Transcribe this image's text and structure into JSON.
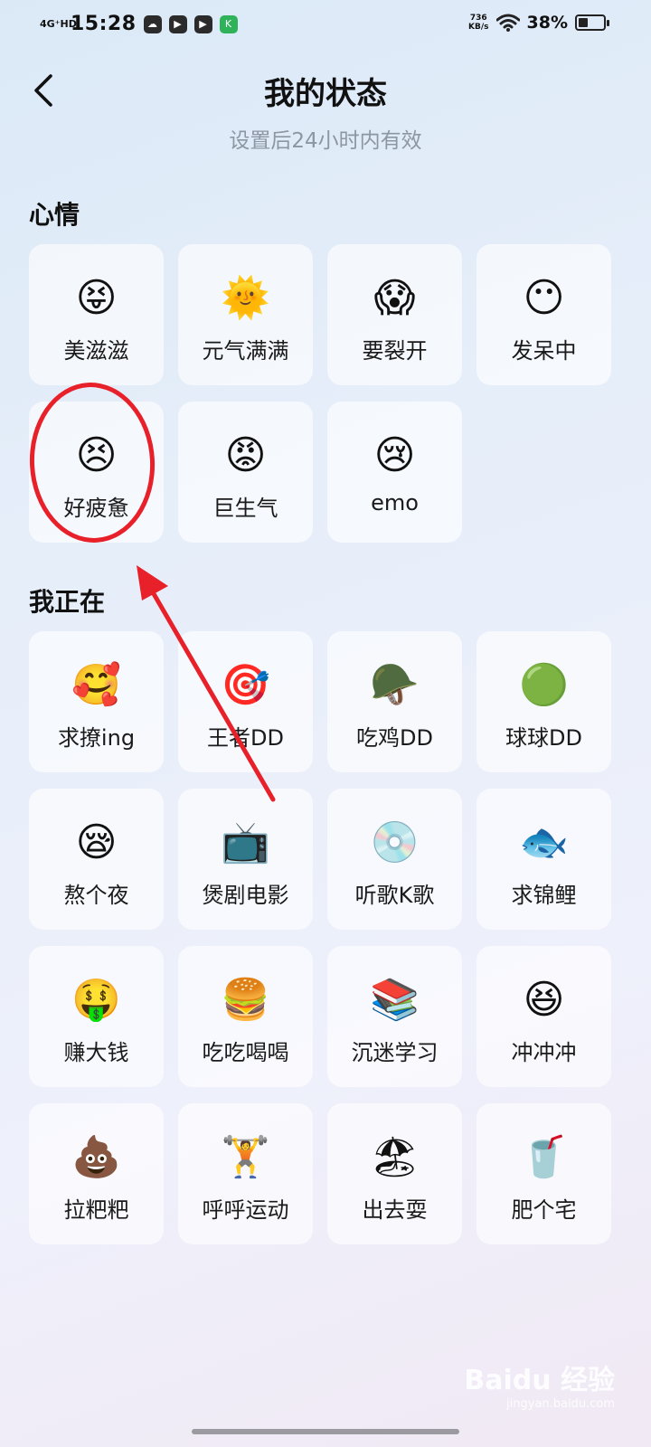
{
  "status_bar": {
    "network": "4G⁺HD",
    "time": "15:28",
    "speed_value": "736",
    "speed_unit": "KB/s",
    "battery_text": "38%",
    "battery_level": 0.38,
    "app_icons": [
      "cloud-icon",
      "play-icon",
      "play-icon",
      "k-app-icon"
    ]
  },
  "header": {
    "title": "我的状态",
    "subtitle": "设置后24小时内有效"
  },
  "mood": {
    "heading": "心情",
    "items": [
      {
        "label": "美滋滋",
        "emoji": "😝",
        "icon": "happy-face-icon"
      },
      {
        "label": "元气满满",
        "emoji": "🌞",
        "icon": "sun-face-icon"
      },
      {
        "label": "要裂开",
        "emoji": "😱",
        "icon": "cracked-face-icon"
      },
      {
        "label": "发呆中",
        "emoji": "😶",
        "icon": "dazed-face-icon"
      },
      {
        "label": "好疲惫",
        "emoji": "😣",
        "icon": "tired-face-icon"
      },
      {
        "label": "巨生气",
        "emoji": "😡",
        "icon": "angry-face-icon"
      },
      {
        "label": "emo",
        "emoji": "😢",
        "icon": "crying-face-icon"
      }
    ]
  },
  "doing": {
    "heading": "我正在",
    "items": [
      {
        "label": "求撩ing",
        "emoji": "🥰",
        "icon": "heart-face-icon"
      },
      {
        "label": "王者DD",
        "emoji": "🎯",
        "icon": "honor-of-kings-icon"
      },
      {
        "label": "吃鸡DD",
        "emoji": "🪖",
        "icon": "helmet-icon"
      },
      {
        "label": "球球DD",
        "emoji": "🟢",
        "icon": "ball-game-icon"
      },
      {
        "label": "熬个夜",
        "emoji": "😪",
        "icon": "sleepy-face-icon"
      },
      {
        "label": "煲剧电影",
        "emoji": "📺",
        "icon": "tv-icon"
      },
      {
        "label": "听歌K歌",
        "emoji": "💿",
        "icon": "record-icon"
      },
      {
        "label": "求锦鲤",
        "emoji": "🐟",
        "icon": "koi-icon"
      },
      {
        "label": "赚大钱",
        "emoji": "🤑",
        "icon": "money-face-icon"
      },
      {
        "label": "吃吃喝喝",
        "emoji": "🍔",
        "icon": "burger-icon"
      },
      {
        "label": "沉迷学习",
        "emoji": "📚",
        "icon": "study-icon"
      },
      {
        "label": "冲冲冲",
        "emoji": "😆",
        "icon": "excited-face-icon"
      },
      {
        "label": "拉粑粑",
        "emoji": "💩",
        "icon": "poop-icon"
      },
      {
        "label": "呼呼运动",
        "emoji": "🏋",
        "icon": "dumbbell-icon"
      },
      {
        "label": "出去耍",
        "emoji": "🏖",
        "icon": "beach-umbrella-icon"
      },
      {
        "label": "肥个宅",
        "emoji": "🥤",
        "icon": "soda-cup-icon"
      }
    ]
  },
  "watermark": {
    "main": "Baidu 经验",
    "sub": "jingyan.baidu.com"
  }
}
